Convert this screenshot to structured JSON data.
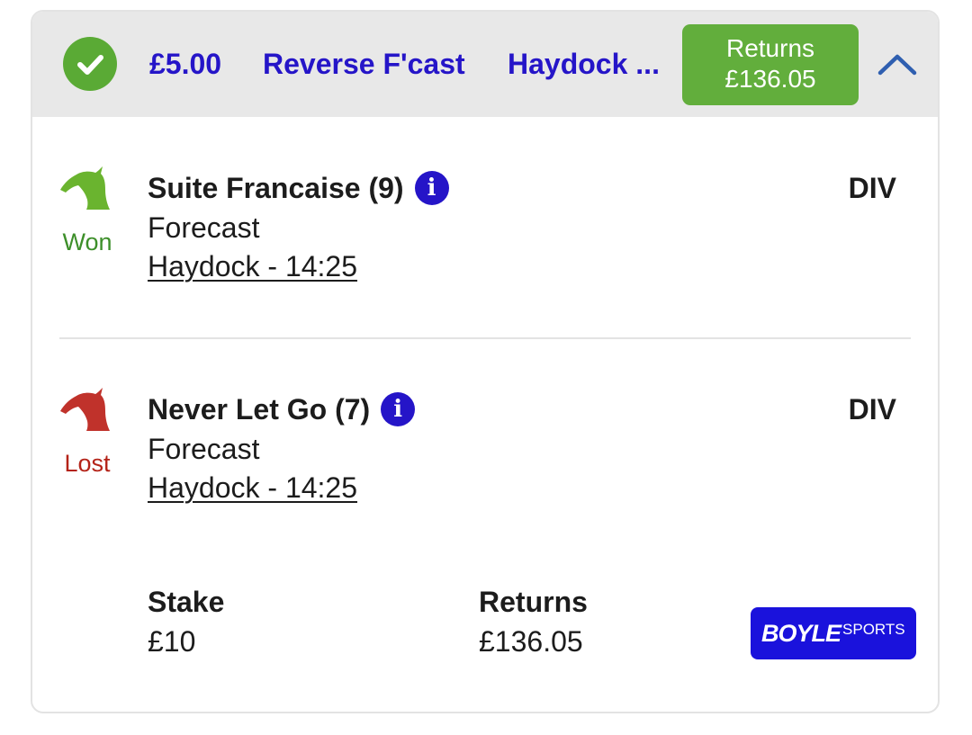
{
  "header": {
    "stake": "£5.00",
    "bet_type": "Reverse F'cast",
    "event": "Haydock ...",
    "returns_label": "Returns",
    "returns_value": "£136.05",
    "status_color": "#5aaa35",
    "accent_color": "#2515c8"
  },
  "selections": [
    {
      "runner": "Suite Francaise (9)",
      "result": "Won",
      "bet_type": "Forecast",
      "race": "Haydock - 14:25",
      "odds": "DIV",
      "icon": "horse-head-icon",
      "color": "#6ab42f"
    },
    {
      "runner": "Never Let Go (7)",
      "result": "Lost",
      "bet_type": "Forecast",
      "race": "Haydock - 14:25",
      "odds": "DIV",
      "icon": "horse-head-icon",
      "color": "#c0322b"
    }
  ],
  "footer": {
    "stake_label": "Stake",
    "stake_value": "£10",
    "returns_label": "Returns",
    "returns_value": "£136.05",
    "brand_main": "BOYLE",
    "brand_sub": "SPORTS",
    "brand_color": "#1a12dc"
  },
  "icons": {
    "info": "i"
  }
}
